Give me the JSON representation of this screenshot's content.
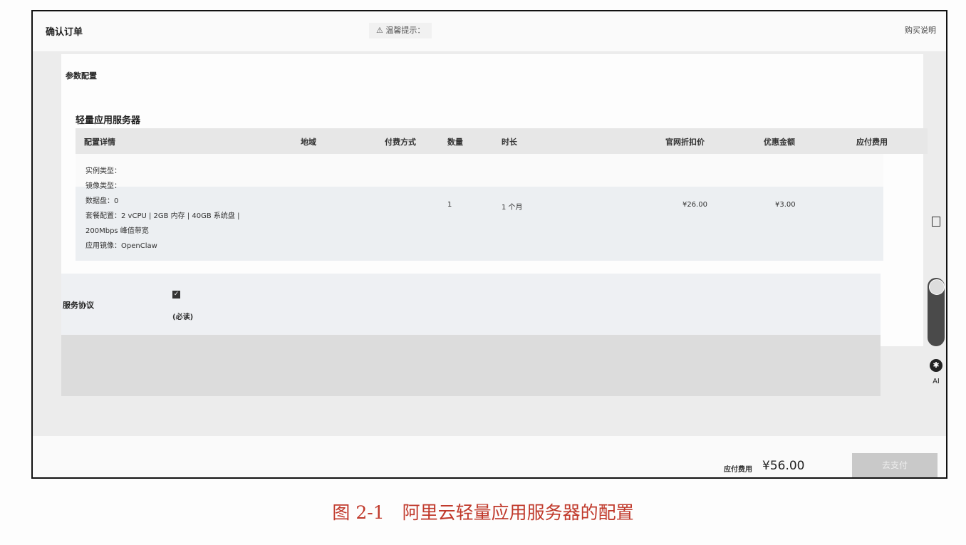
{
  "header": {
    "title": "确认订单",
    "notice": "⚠ 温馨提示：",
    "help": "购买说明"
  },
  "config": {
    "section_label": "参数配置",
    "product_title": "轻量应用服务器",
    "columns": [
      "配置详情",
      "地域",
      "付费方式",
      "数量",
      "时长",
      "官网折扣价",
      "优惠金额",
      "应付费用"
    ],
    "details": [
      "实例类型：",
      "镜像类型：",
      "数据盘：0",
      "套餐配置：2 vCPU | 2GB 内存 | 40GB 系统盘 |",
      "200Mbps 峰值带宽",
      "应用镜像：OpenClaw"
    ],
    "row": {
      "quantity": "1",
      "duration": "1 个月",
      "list_price": "¥26.00",
      "discount": "¥3.00"
    }
  },
  "agreement": {
    "label": "服务协议",
    "note": "(必读)"
  },
  "footer": {
    "total_label": "应付费用",
    "total_value": "¥56.00",
    "pay_button": "去支付"
  },
  "sidebar": {
    "ai_label": "AI"
  },
  "caption": "图 2-1　阿里云轻量应用服务器的配置"
}
